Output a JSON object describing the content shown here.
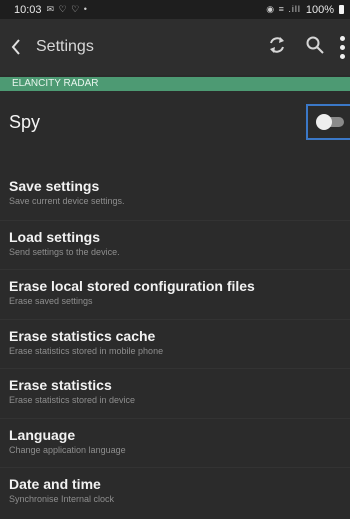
{
  "status_bar": {
    "time": "10:03",
    "left_icons": "✉ ♡ ♡ •",
    "right_icons": "◉ ≡ .ill",
    "battery": "100%"
  },
  "app_bar": {
    "title": "Settings",
    "back_icon": "chevron-left-icon",
    "refresh_icon": "refresh-icon",
    "search_icon": "search-icon",
    "overflow_icon": "more-vertical-icon"
  },
  "section": {
    "header": "ELANCITY RADAR"
  },
  "spy": {
    "label": "Spy",
    "enabled": false
  },
  "settings": [
    {
      "title": "Save settings",
      "subtitle": "Save current device settings."
    },
    {
      "title": "Load settings",
      "subtitle": "Send settings to the device."
    },
    {
      "title": "Erase local stored configuration files",
      "subtitle": "Erase saved settings"
    },
    {
      "title": "Erase statistics cache",
      "subtitle": "Erase statistics stored in mobile phone"
    },
    {
      "title": "Erase statistics",
      "subtitle": "Erase statistics stored in device"
    },
    {
      "title": "Language",
      "subtitle": "Change application language"
    },
    {
      "title": "Date and time",
      "subtitle": "Synchronise Internal clock"
    }
  ],
  "colors": {
    "background": "#2b2b2b",
    "section_header": "#4d9a73",
    "focus_outline": "#3b78c7"
  }
}
